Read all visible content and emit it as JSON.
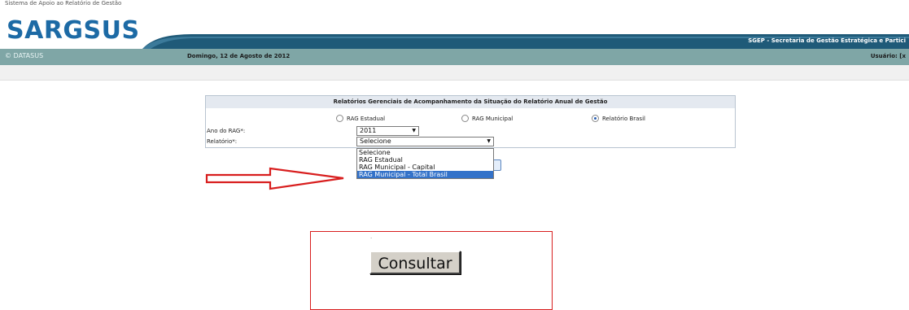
{
  "header": {
    "system_name": "Sistema de Apoio ao Relatório de Gestão",
    "logo_text": "SARGSUS",
    "secretaria": "SGEP - Secretaria de Gestão Estratégica e Partici",
    "brand_color": "#1c6aa5"
  },
  "navbar": {
    "datasus": "© DATASUS",
    "date": "Domingo, 12 de Agosto de 2012",
    "user_label": "Usuário:  [x"
  },
  "form": {
    "title": "Relatórios Gerenciais de Acompanhamento da Situação do Relatório Anual de Gestão",
    "radios": [
      {
        "label": "RAG Estadual",
        "checked": false
      },
      {
        "label": "RAG Municipal",
        "checked": false
      },
      {
        "label": "Relatório Brasil",
        "checked": true
      }
    ],
    "ano_label": "Ano do RAG*:",
    "ano_value": "2011",
    "relatorio_label": "Relatório*:",
    "relatorio_value": "Selecione",
    "dropdown_options": [
      "Selecione",
      "RAG Estadual",
      "RAG Municipal - Capital",
      "RAG Municipal - Total Brasil"
    ],
    "highlighted_option": "RAG Municipal - Total Brasil"
  },
  "annotation": {
    "arrow_color": "#d81e1e",
    "box_color": "#d81e1e"
  },
  "consult": {
    "label": "Consultar"
  }
}
